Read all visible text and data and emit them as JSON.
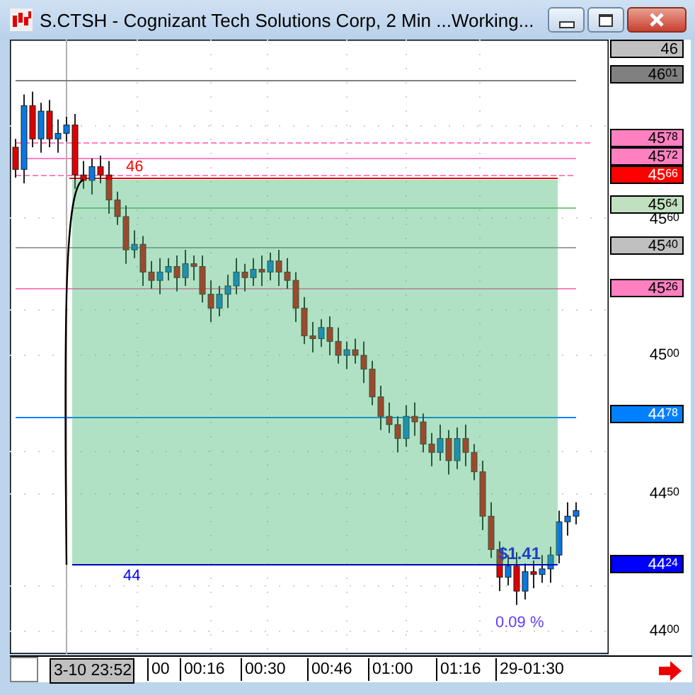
{
  "window": {
    "title": "S.CTSH - Cognizant Tech Solutions Corp, 2 Min ...Working..."
  },
  "price_axis": {
    "labels": [
      {
        "text": "46",
        "kind": "marker",
        "color": "#c0c0c0"
      },
      {
        "text": "46$^{01}$",
        "kind": "marker",
        "color": "#808080"
      },
      {
        "text": "45$^{78}$",
        "kind": "marker",
        "color": "#ff80c0"
      },
      {
        "text": "45$^{72}$",
        "kind": "marker",
        "color": "#ff80c0"
      },
      {
        "text": "45$^{66}$",
        "kind": "alert",
        "color": "#ff0000"
      },
      {
        "text": "45$^{64}$",
        "kind": "marker",
        "color": "#c0e0c0"
      },
      {
        "text": "45$^{60}$",
        "kind": "tick"
      },
      {
        "text": "45$^{40}$",
        "kind": "marker",
        "color": "#c0c0c0"
      },
      {
        "text": "45$^{26}$",
        "kind": "marker",
        "color": "#ff80c0"
      },
      {
        "text": "45$^{00}$",
        "kind": "tick"
      },
      {
        "text": "44$^{78}$",
        "kind": "alert",
        "color": "#0080ff"
      },
      {
        "text": "44$^{50}$",
        "kind": "tick"
      },
      {
        "text": "44$^{24}$",
        "kind": "alert",
        "color": "#0000ff"
      },
      {
        "text": "44$^{00}$",
        "kind": "tick"
      }
    ]
  },
  "chart": {
    "labels": [
      {
        "text": "46",
        "color": "#ff0000"
      },
      {
        "text": "44",
        "color": "#0000ff"
      },
      {
        "text": "$1.41",
        "color": "#2040c0"
      },
      {
        "text": "0.09 %",
        "color": "#6040ff"
      }
    ]
  },
  "time_axis": {
    "labels": [
      {
        "text": "3-10  23:52",
        "highlighted": true
      },
      {
        "text": "00",
        "highlighted": false
      },
      {
        "text": "00:16",
        "highlighted": false
      },
      {
        "text": "00:30",
        "highlighted": false
      },
      {
        "text": "00:46",
        "highlighted": false
      },
      {
        "text": "01:00",
        "highlighted": false
      },
      {
        "text": "01:16",
        "highlighted": false
      },
      {
        "text": "29-01:30",
        "highlighted": false
      }
    ]
  }
}
